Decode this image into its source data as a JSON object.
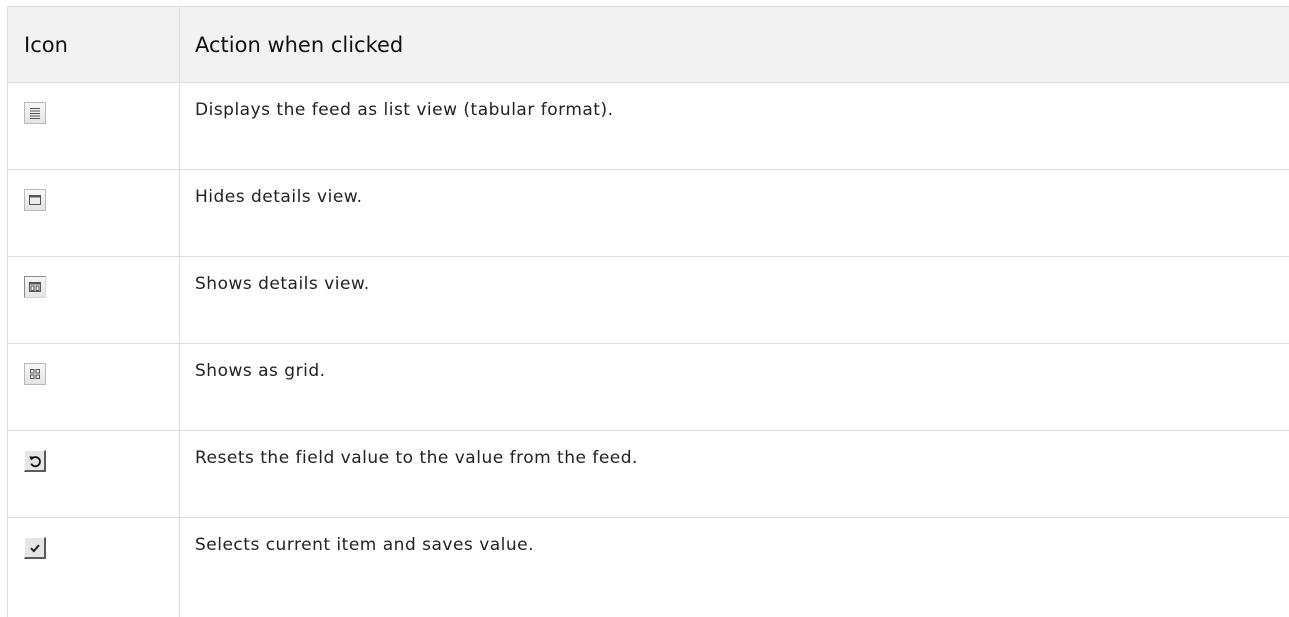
{
  "table": {
    "headers": {
      "icon": "Icon",
      "action": "Action when clicked"
    },
    "rows": [
      {
        "icon": "list-view-icon",
        "action": "Displays the feed as list view (tabular format)."
      },
      {
        "icon": "hide-details-icon",
        "action": "Hides details view."
      },
      {
        "icon": "show-details-icon",
        "action": "Shows details view."
      },
      {
        "icon": "grid-view-icon",
        "action": "Shows as grid."
      },
      {
        "icon": "reset-icon",
        "action": "Resets the field value to the value from the feed."
      },
      {
        "icon": "checkmark-icon",
        "action": "Selects current item and saves value."
      }
    ]
  }
}
